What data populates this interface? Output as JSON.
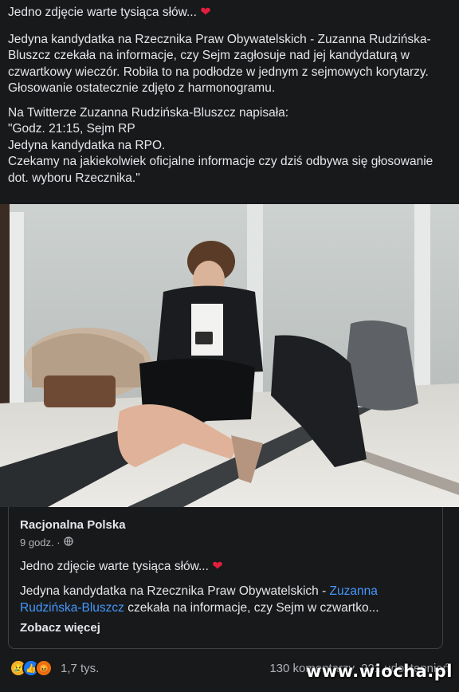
{
  "post": {
    "title": "Jedno zdjęcie warte tysiąca słów...",
    "paragraph1": "Jedyna kandydatka na Rzecznika Praw Obywatelskich - Zuzanna Rudzińska-Bluszcz czekała na informacje, czy Sejm zagłosuje nad jej kandydaturą w czwartkowy wieczór. Robiła to na podłodze w jednym z sejmowych korytarzy. Głosowanie ostatecznie zdjęto z harmonogramu.",
    "quote_lines": [
      "Na Twitterze Zuzanna Rudzińska-Bluszcz napisała:",
      "\"Godz. 21:15, Sejm RP",
      "Jedyna kandydatka na RPO.",
      "Czekamy na jakiekolwiek oficjalne informacje czy dziś odbywa się głosowanie dot. wyboru Rzecznika.\""
    ]
  },
  "shared_post": {
    "page_name": "Racjonalna Polska",
    "time": "9 godz. ·",
    "title": "Jedno zdjęcie warte tysiąca słów...",
    "text_before_link": "Jedyna kandydatka na Rzecznika Praw Obywatelskich - ",
    "link_text": "Zuzanna Rudzińska-Bluszcz",
    "text_after_link": " czekała na informacje, czy Sejm w czwartko...",
    "see_more": "Zobacz więcej"
  },
  "footer": {
    "reaction_count": "1,7 tys.",
    "comments": "130 komentarzy",
    "shares": "221 udostępnień"
  },
  "watermark": "www.wiocha.pl",
  "colors": {
    "background": "#18191a",
    "link": "#4599ff",
    "heart": "#e41e3f"
  }
}
